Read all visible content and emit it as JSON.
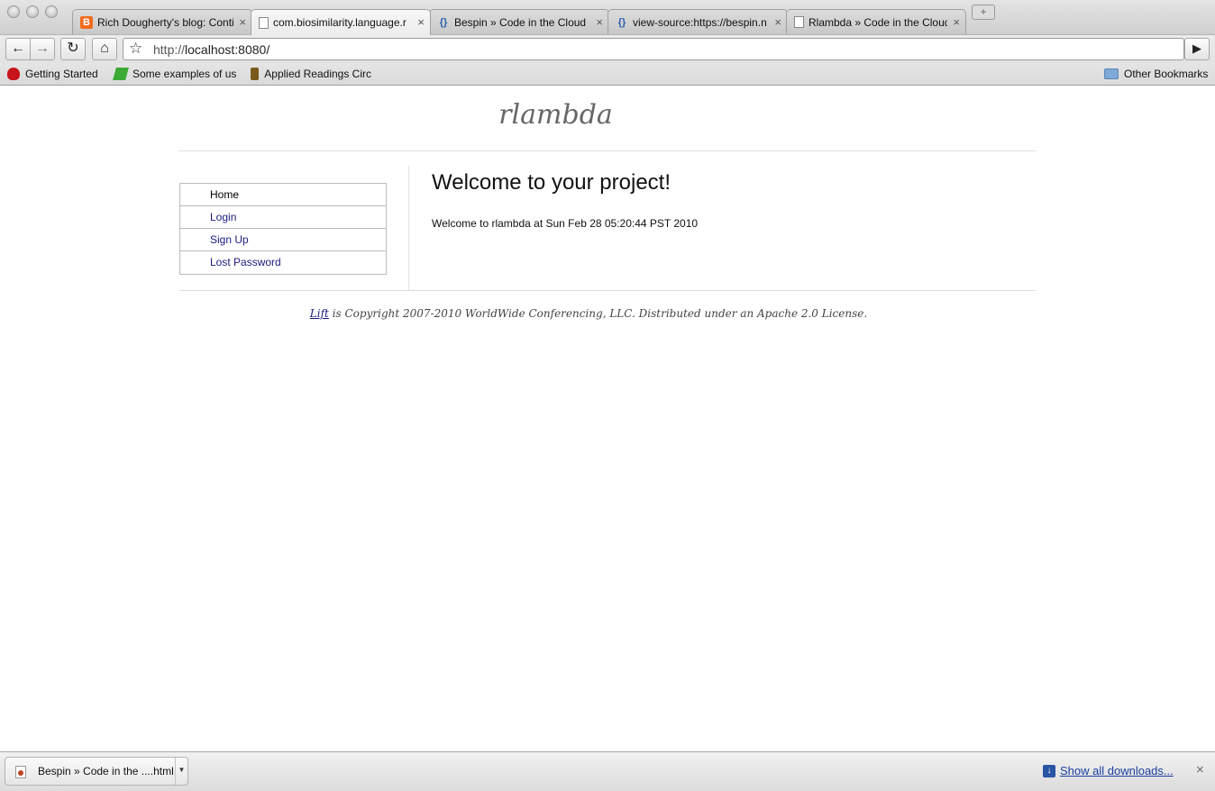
{
  "browser": {
    "tabs": [
      {
        "title": "Rich Dougherty's blog: Continu",
        "icon": "blogger-icon"
      },
      {
        "title": "com.biosimilarity.language.r",
        "icon": "page-icon"
      },
      {
        "title": "Bespin » Code in the Cloud",
        "icon": "braces-icon"
      },
      {
        "title": "view-source:https://bespin.n",
        "icon": "braces-icon"
      },
      {
        "title": "Rlambda » Code in the Cloud",
        "icon": "page-icon"
      }
    ],
    "close_glyph": "×",
    "new_tab_glyph": "+",
    "url_scheme": "http://",
    "url_rest": "localhost:8080/",
    "bookmarks": [
      {
        "label": "Getting Started"
      },
      {
        "label": "Some examples of us"
      },
      {
        "label": "Applied Readings Circ"
      }
    ],
    "other_bookmarks": "Other Bookmarks"
  },
  "site": {
    "title": "rlambda",
    "nav": [
      {
        "label": "Home"
      },
      {
        "label": "Login"
      },
      {
        "label": "Sign Up"
      },
      {
        "label": "Lost Password"
      }
    ],
    "heading": "Welcome to your project!",
    "welcome_text": "Welcome to rlambda at Sun Feb 28 05:20:44 PST 2010",
    "footer_link": "Lift",
    "footer_text": " is Copyright 2007-2010 WorldWide Conferencing, LLC. Distributed under an Apache 2.0 License."
  },
  "downloads": {
    "item_name": "Bespin » Code in the ....html",
    "show_all": "Show all downloads..."
  }
}
